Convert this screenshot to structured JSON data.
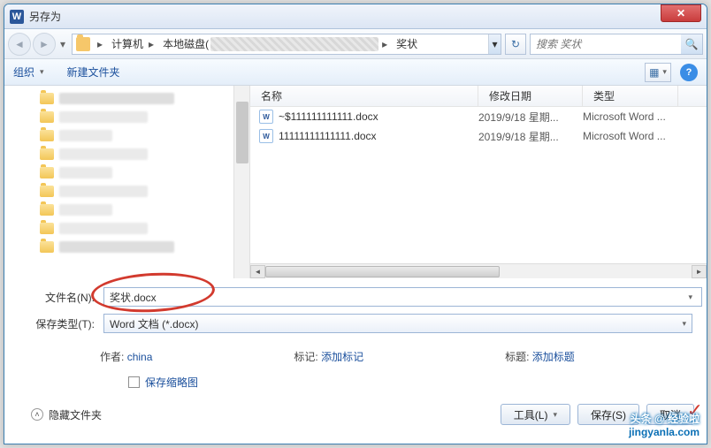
{
  "titlebar": {
    "title": "另存为",
    "close": "✕"
  },
  "nav": {
    "back": "◄",
    "forward": "►",
    "breadcrumb": [
      "计算机",
      "本地磁盘(",
      "奖状"
    ],
    "refresh": "↻"
  },
  "search": {
    "placeholder": "搜索 奖状",
    "icon": "🔍"
  },
  "toolbar": {
    "organize": "组织",
    "new_folder": "新建文件夹",
    "view": "▦",
    "help": "?"
  },
  "columns": {
    "name": "名称",
    "date": "修改日期",
    "type": "类型"
  },
  "files": [
    {
      "name": "~$111111111111.docx",
      "date": "2019/9/18 星期...",
      "type": "Microsoft Word ..."
    },
    {
      "name": "11111111111111.docx",
      "date": "2019/9/18 星期...",
      "type": "Microsoft Word ..."
    }
  ],
  "form": {
    "filename_label": "文件名(N):",
    "filename": "奖状.docx",
    "type_label": "保存类型(T):",
    "type_value": "Word 文档 (*.docx)"
  },
  "meta": {
    "author_label": "作者:",
    "author": "china",
    "tag_label": "标记:",
    "tag_link": "添加标记",
    "title_label": "标题:",
    "title_link": "添加标题"
  },
  "thumb_chk": "保存缩略图",
  "footer": {
    "collapse": "隐藏文件夹",
    "tools": "工具(L)",
    "save": "保存(S)",
    "cancel": "取消"
  },
  "watermark": {
    "line1": "头条 @ 经验啦",
    "line2": "jingyanla.com"
  }
}
